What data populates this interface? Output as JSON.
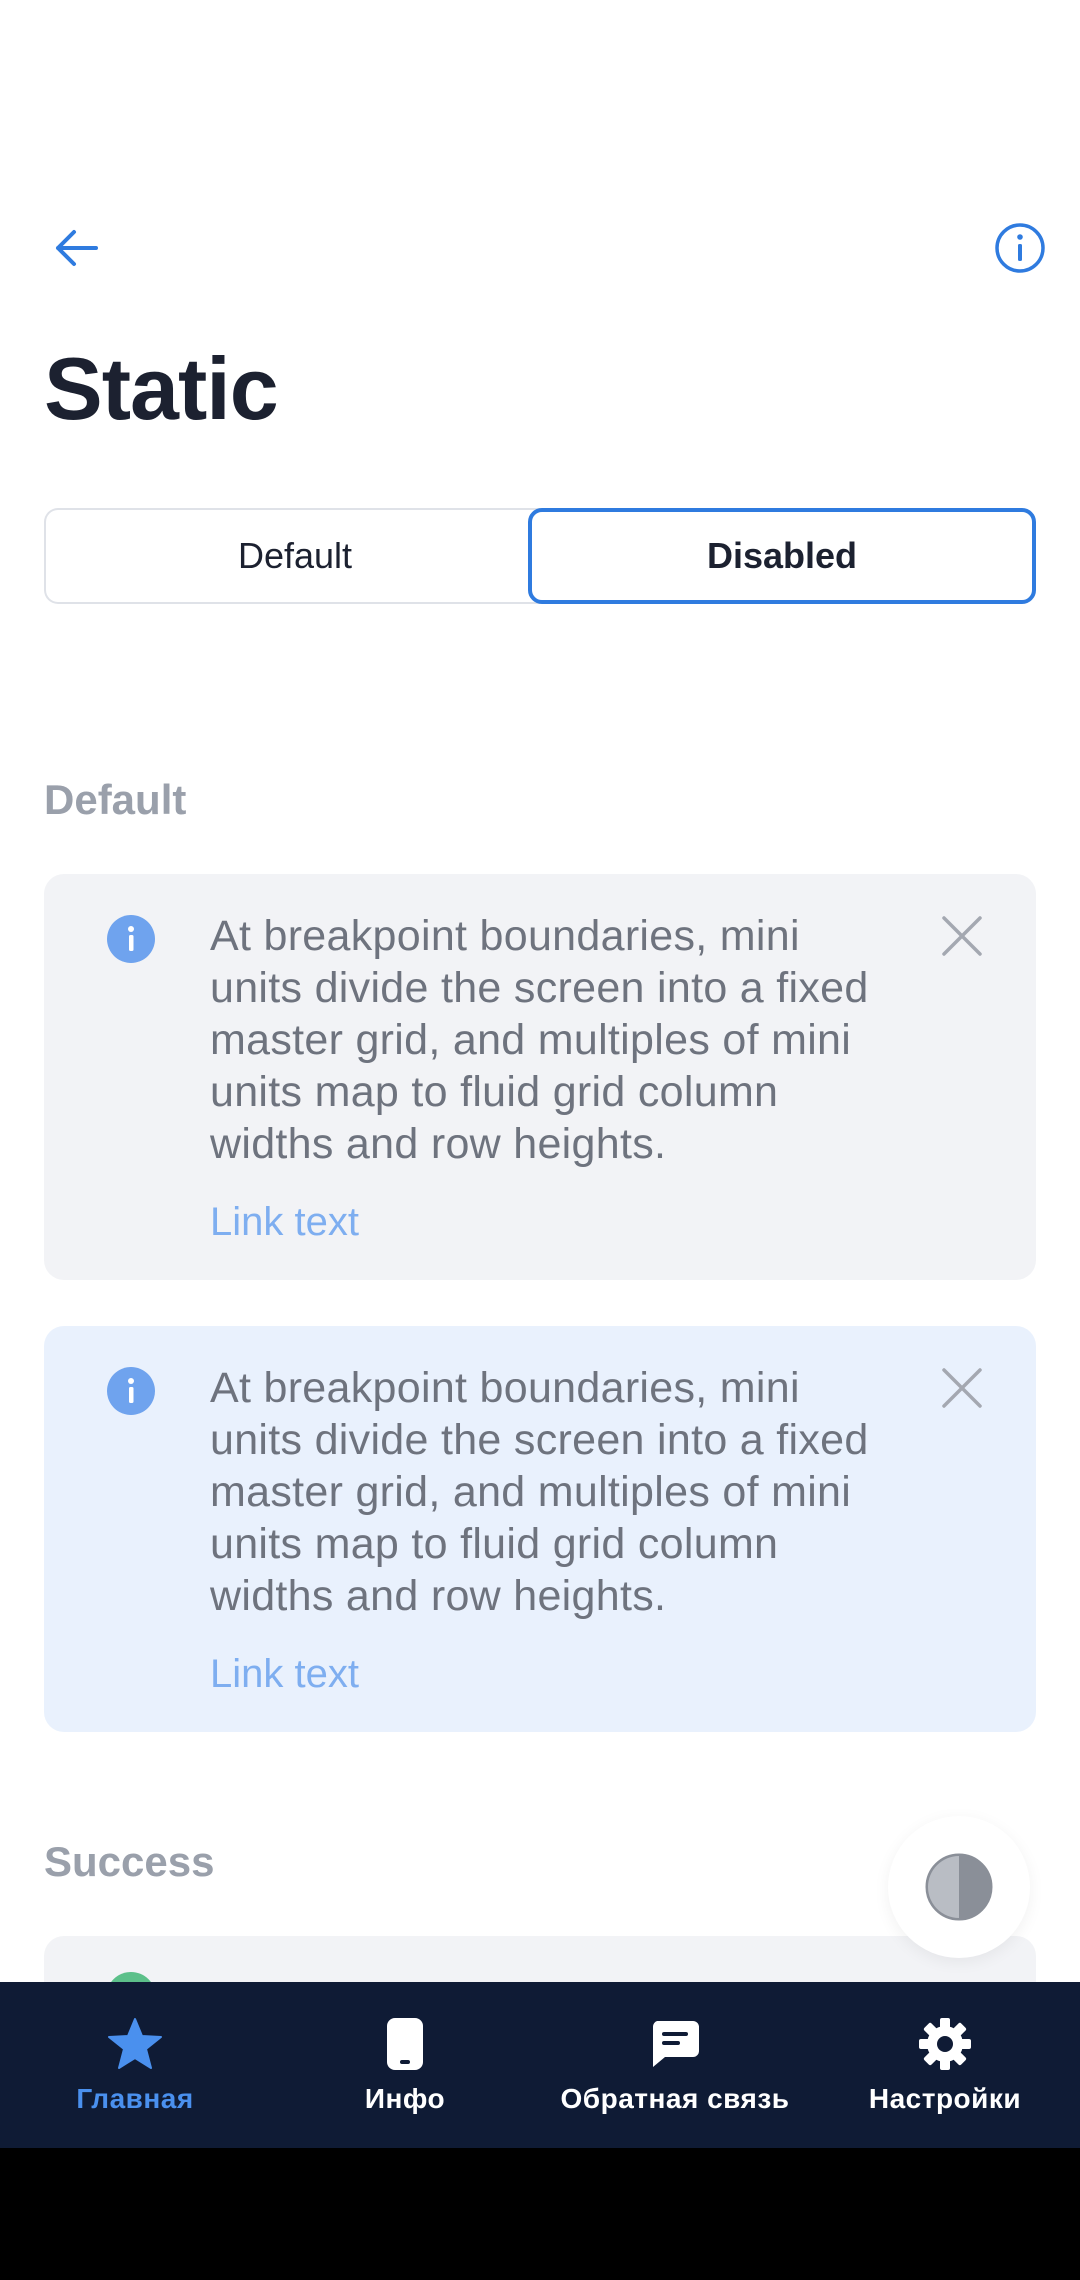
{
  "header": {
    "back_icon": "arrow-left-icon",
    "info_icon": "info-circle-icon",
    "title": "Static"
  },
  "segmented": {
    "options": [
      "Default",
      "Disabled"
    ],
    "selected": "Disabled"
  },
  "sections": {
    "default_label": "Default",
    "success_label": "Success"
  },
  "notes": [
    {
      "variant": "gray",
      "text": "At breakpoint boundaries, mini units divide the screen into a fixed master grid, and multiples of mini units map to fluid grid column widths and row heights.",
      "link": "Link text"
    },
    {
      "variant": "blue",
      "text": "At breakpoint boundaries, mini units divide the screen into a fixed master grid, and multiples of mini units map to fluid grid column widths and row heights.",
      "link": "Link text"
    }
  ],
  "theme_toggle_icon": "contrast-icon",
  "nav": {
    "items": [
      {
        "label": "Главная",
        "icon": "star-icon",
        "active": true
      },
      {
        "label": "Инфо",
        "icon": "phone-icon",
        "active": false
      },
      {
        "label": "Обратная связь",
        "icon": "chat-icon",
        "active": false
      },
      {
        "label": "Настройки",
        "icon": "gear-icon",
        "active": false
      }
    ]
  },
  "colors": {
    "accent": "#2f7bdf",
    "nav_bg": "#0f1b35",
    "nav_active": "#4a90ee"
  }
}
